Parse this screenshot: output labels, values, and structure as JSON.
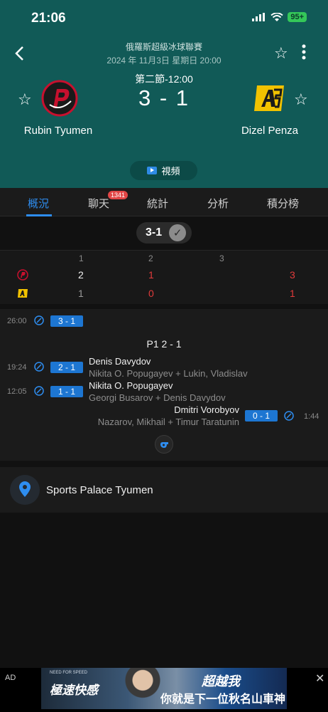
{
  "status_bar": {
    "time": "21:06",
    "battery": "95+"
  },
  "match": {
    "league": "俄羅斯超級冰球聯賽",
    "datetime": "2024 年 11月3日 星期日 20:00",
    "period": "第二節-12:00",
    "score": "3 - 1",
    "home": {
      "name": "Rubin Tyumen",
      "logo": "rubin-logo"
    },
    "away": {
      "name": "Dizel Penza",
      "logo": "dizel-logo"
    },
    "video_label": "視頻"
  },
  "tabs": [
    {
      "label": "概況",
      "active": true
    },
    {
      "label": "聊天",
      "badge": "1341"
    },
    {
      "label": "統計"
    },
    {
      "label": "分析"
    },
    {
      "label": "積分榜"
    }
  ],
  "score_pill": "3-1",
  "periods_table": {
    "headers": [
      "1",
      "2",
      "3"
    ],
    "rows": [
      {
        "team": "Rubin Tyumen",
        "values": [
          "2",
          "1",
          ""
        ],
        "total": "3"
      },
      {
        "team": "Dizel Penza",
        "values": [
          "1",
          "0",
          ""
        ],
        "total": "1"
      }
    ]
  },
  "events": {
    "top": {
      "time": "26:00",
      "score": "3 - 1"
    },
    "period_label": "P1 2 - 1",
    "goals": [
      {
        "time": "19:24",
        "score": "2 - 1",
        "scorer": "Denis Davydov",
        "assist": "Nikita O. Popugayev + Lukin, Vladislav",
        "side": "home"
      },
      {
        "time": "12:05",
        "score": "1 - 1",
        "scorer": "Nikita O. Popugayev",
        "assist": "Georgi Busarov + Denis Davydov",
        "side": "home"
      },
      {
        "time": "1:44",
        "score": "0 - 1",
        "scorer": "Dmitri Vorobyov",
        "assist": "Nazarov, Mikhail + Timur Taratunin",
        "side": "away"
      }
    ]
  },
  "venue": {
    "name": "Sports Palace Tyumen"
  },
  "ad": {
    "label": "AD",
    "close": "✕",
    "brand": "NEED FOR SPEED",
    "left_text": "極速快感",
    "right_line1": "超越我",
    "right_line2": "你就是下一位秋名山車神"
  },
  "colors": {
    "header_bg": "#115a57",
    "accent": "#2e8df0",
    "score_badge": "#1d76d2",
    "red": "#e23b3b"
  }
}
